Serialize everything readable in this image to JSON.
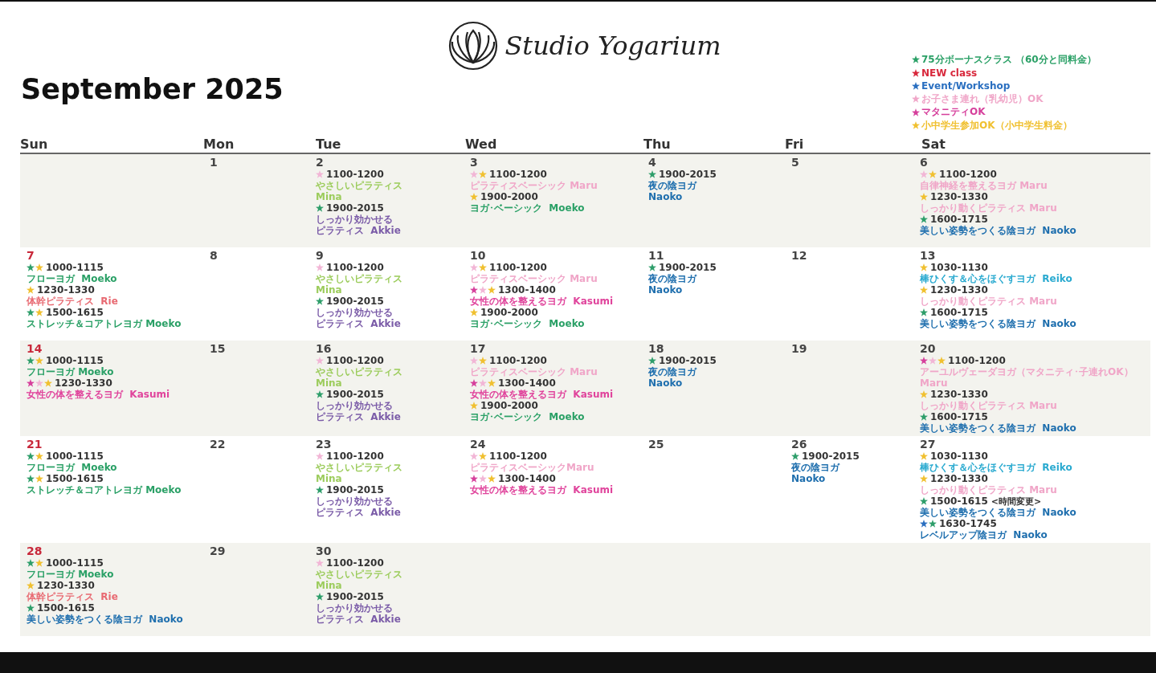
{
  "logo": {
    "text": "Studio Yogarium"
  },
  "title": "September 2025",
  "legend": [
    {
      "color": "#2aa066",
      "text": "75分ボーナスクラス （60分と同料金）"
    },
    {
      "color": "#d8283c",
      "text": "NEW class"
    },
    {
      "color": "#2a6fc0",
      "text": "Event/Workshop"
    },
    {
      "color": "#f0a6c8",
      "text": "お子さま連れ（乳幼児）OK"
    },
    {
      "color": "#d6409c",
      "text": "マタニティOK"
    },
    {
      "color": "#f0c030",
      "text": "小中学生参加OK（小中学生料金）"
    }
  ],
  "weekdays": [
    "Sun",
    "Mon",
    "Tue",
    "Wed",
    "Thu",
    "Fri",
    "Sat"
  ],
  "weeks": [
    {
      "shaded": true,
      "days": [
        {
          "date": "1"
        },
        {
          "date": "2",
          "classes": [
            {
              "stars": [
                {
                  "color": "#f2b6d6"
                }
              ],
              "time": "1100-1200",
              "lines": [
                "やさしいピラティス",
                "Mina"
              ],
              "color": "#9ccc5c"
            },
            {
              "stars": [
                {
                  "color": "#2e9e6a"
                }
              ],
              "time": "1900-2015",
              "lines": [
                "しっかり効かせる",
                "ピラティス  Akkie"
              ],
              "color": "#7b5ca8"
            }
          ]
        },
        {
          "date": "3",
          "classes": [
            {
              "stars": [
                {
                  "color": "#f2b6d6"
                },
                {
                  "color": "#f0c030"
                }
              ],
              "time": "1100-1200",
              "lines": [
                "ピラティスベーシック Maru"
              ],
              "color": "#f0a6c8"
            },
            {
              "stars": [
                {
                  "color": "#f0c030"
                }
              ],
              "time": "1900-2000",
              "lines": [
                "ヨガ･ベーシック  Moeko"
              ],
              "color": "#2aa066"
            }
          ]
        },
        {
          "date": "4",
          "classes": [
            {
              "stars": [
                {
                  "color": "#2e9e6a"
                }
              ],
              "time": "1900-2015",
              "lines": [
                "夜の陰ヨガ",
                "Naoko"
              ],
              "color": "#1f6fae"
            }
          ]
        },
        {
          "date": "5"
        },
        {
          "date": "6",
          "classes": [
            {
              "stars": [
                {
                  "color": "#f2b6d6"
                },
                {
                  "color": "#f0c030"
                }
              ],
              "time": "1100-1200",
              "lines": [
                "自律神経を整えるヨガ Maru"
              ],
              "color": "#f0a6c8"
            },
            {
              "stars": [
                {
                  "color": "#f0c030"
                }
              ],
              "time": "1230-1330",
              "lines": [
                "しっかり動くピラティス Maru"
              ],
              "color": "#f0a6c8"
            },
            {
              "stars": [
                {
                  "color": "#2e9e6a"
                }
              ],
              "time": "1600-1715",
              "lines": [
                "美しい姿勢をつくる陰ヨガ  Naoko"
              ],
              "color": "#1f6fae"
            }
          ]
        }
      ]
    },
    {
      "shaded": false,
      "days": [
        {
          "date": "7",
          "classes": [
            {
              "stars": [
                {
                  "color": "#2e9e6a"
                },
                {
                  "color": "#f0c030"
                }
              ],
              "time": "1000-1115",
              "lines": [
                "フローヨガ  Moeko"
              ],
              "color": "#2aa066"
            },
            {
              "stars": [
                {
                  "color": "#f0c030"
                }
              ],
              "time": "1230-1330",
              "lines": [
                "体幹ピラティス  Rie"
              ],
              "color": "#e86a72"
            },
            {
              "stars": [
                {
                  "color": "#2e9e6a"
                },
                {
                  "color": "#f0c030"
                }
              ],
              "time": "1500-1615",
              "lines": [
                "ストレッチ＆コアトレヨガ Moeko"
              ],
              "color": "#2aa066"
            }
          ]
        },
        {
          "date": "8"
        },
        {
          "date": "9",
          "classes": [
            {
              "stars": [
                {
                  "color": "#f2b6d6"
                }
              ],
              "time": "1100-1200",
              "lines": [
                "やさしいピラティス",
                "Mina"
              ],
              "color": "#9ccc5c"
            },
            {
              "stars": [
                {
                  "color": "#2e9e6a"
                }
              ],
              "time": "1900-2015",
              "lines": [
                "しっかり効かせる",
                "ピラティス  Akkie"
              ],
              "color": "#7b5ca8"
            }
          ]
        },
        {
          "date": "10",
          "classes": [
            {
              "stars": [
                {
                  "color": "#f2b6d6"
                },
                {
                  "color": "#f0c030"
                }
              ],
              "time": "1100-1200",
              "lines": [
                "ピラティスベーシック Maru"
              ],
              "color": "#f0a6c8"
            },
            {
              "stars": [
                {
                  "color": "#d6409c"
                },
                {
                  "color": "#f2b6d6"
                },
                {
                  "color": "#f0c030"
                }
              ],
              "time": "1300-1400",
              "lines": [
                "女性の体を整えるヨガ  Kasumi"
              ],
              "color": "#e0449c"
            },
            {
              "stars": [
                {
                  "color": "#f0c030"
                }
              ],
              "time": "1900-2000",
              "lines": [
                "ヨガ･ベーシック  Moeko"
              ],
              "color": "#2aa066"
            }
          ]
        },
        {
          "date": "11",
          "classes": [
            {
              "stars": [
                {
                  "color": "#2e9e6a"
                }
              ],
              "time": "1900-2015",
              "lines": [
                "夜の陰ヨガ",
                "Naoko"
              ],
              "color": "#1f6fae"
            }
          ]
        },
        {
          "date": "12"
        },
        {
          "date": "13",
          "classes": [
            {
              "stars": [
                {
                  "color": "#f0c030"
                }
              ],
              "time": "1030-1130",
              "lines": [
                "棒ひくす＆心をほぐすヨガ  Reiko"
              ],
              "color": "#2aaad0"
            },
            {
              "stars": [
                {
                  "color": "#f0c030"
                }
              ],
              "time": "1230-1330",
              "lines": [
                "しっかり動くピラティス Maru"
              ],
              "color": "#f0a6c8"
            },
            {
              "stars": [
                {
                  "color": "#2e9e6a"
                }
              ],
              "time": "1600-1715",
              "lines": [
                "美しい姿勢をつくる陰ヨガ  Naoko"
              ],
              "color": "#1f6fae"
            }
          ]
        }
      ]
    },
    {
      "shaded": true,
      "days": [
        {
          "date": "14",
          "classes": [
            {
              "stars": [
                {
                  "color": "#2e9e6a"
                },
                {
                  "color": "#f0c030"
                }
              ],
              "time": "1000-1115",
              "lines": [
                "フローヨガ Moeko"
              ],
              "color": "#2aa066"
            },
            {
              "stars": [
                {
                  "color": "#d6409c"
                },
                {
                  "color": "#f2b6d6"
                },
                {
                  "color": "#f0c030"
                }
              ],
              "time": "1230-1330",
              "lines": [
                "女性の体を整えるヨガ  Kasumi"
              ],
              "color": "#e0449c"
            }
          ]
        },
        {
          "date": "15"
        },
        {
          "date": "16",
          "classes": [
            {
              "stars": [
                {
                  "color": "#f2b6d6"
                }
              ],
              "time": "1100-1200",
              "lines": [
                "やさしいピラティス",
                "Mina"
              ],
              "color": "#9ccc5c"
            },
            {
              "stars": [
                {
                  "color": "#2e9e6a"
                }
              ],
              "time": "1900-2015",
              "lines": [
                "しっかり効かせる",
                "ピラティス  Akkie"
              ],
              "color": "#7b5ca8"
            }
          ]
        },
        {
          "date": "17",
          "classes": [
            {
              "stars": [
                {
                  "color": "#f2b6d6"
                },
                {
                  "color": "#f0c030"
                }
              ],
              "time": "1100-1200",
              "lines": [
                "ピラティスベーシック Maru"
              ],
              "color": "#f0a6c8"
            },
            {
              "stars": [
                {
                  "color": "#d6409c"
                },
                {
                  "color": "#f2b6d6"
                },
                {
                  "color": "#f0c030"
                }
              ],
              "time": "1300-1400",
              "lines": [
                "女性の体を整えるヨガ  Kasumi"
              ],
              "color": "#e0449c"
            },
            {
              "stars": [
                {
                  "color": "#f0c030"
                }
              ],
              "time": "1900-2000",
              "lines": [
                "ヨガ･ベーシック  Moeko"
              ],
              "color": "#2aa066"
            }
          ]
        },
        {
          "date": "18",
          "classes": [
            {
              "stars": [
                {
                  "color": "#2e9e6a"
                }
              ],
              "time": "1900-2015",
              "lines": [
                "夜の陰ヨガ",
                "Naoko"
              ],
              "color": "#1f6fae"
            }
          ]
        },
        {
          "date": "19"
        },
        {
          "date": "20",
          "classes": [
            {
              "stars": [
                {
                  "color": "#d6409c"
                },
                {
                  "color": "#f2b6d6"
                },
                {
                  "color": "#f0c030"
                }
              ],
              "time": "1100-1200",
              "lines": [
                "アーユルヴェーダヨガ（マタニティ･子連れOK）",
                "Maru"
              ],
              "color": "#f0a6c8"
            },
            {
              "stars": [
                {
                  "color": "#f0c030"
                }
              ],
              "time": "1230-1330",
              "lines": [
                "しっかり動くピラティス Maru"
              ],
              "color": "#f0a6c8"
            },
            {
              "stars": [
                {
                  "color": "#2e9e6a"
                }
              ],
              "time": "1600-1715",
              "lines": [
                "美しい姿勢をつくる陰ヨガ  Naoko"
              ],
              "color": "#1f6fae"
            }
          ]
        }
      ]
    },
    {
      "shaded": false,
      "days": [
        {
          "date": "21",
          "classes": [
            {
              "stars": [
                {
                  "color": "#2e9e6a"
                },
                {
                  "color": "#f0c030"
                }
              ],
              "time": "1000-1115",
              "lines": [
                "フローヨガ  Moeko"
              ],
              "color": "#2aa066"
            },
            {
              "stars": [
                {
                  "color": "#2e9e6a"
                },
                {
                  "color": "#f0c030"
                }
              ],
              "time": "1500-1615",
              "lines": [
                "ストレッチ＆コアトレヨガ Moeko"
              ],
              "color": "#2aa066"
            }
          ]
        },
        {
          "date": "22"
        },
        {
          "date": "23",
          "classes": [
            {
              "stars": [
                {
                  "color": "#f2b6d6"
                }
              ],
              "time": "1100-1200",
              "lines": [
                "やさしいピラティス",
                "Mina"
              ],
              "color": "#9ccc5c"
            },
            {
              "stars": [
                {
                  "color": "#2e9e6a"
                }
              ],
              "time": "1900-2015",
              "lines": [
                "しっかり効かせる",
                "ピラティス  Akkie"
              ],
              "color": "#7b5ca8"
            }
          ]
        },
        {
          "date": "24",
          "classes": [
            {
              "stars": [
                {
                  "color": "#f2b6d6"
                },
                {
                  "color": "#f0c030"
                }
              ],
              "time": "1100-1200",
              "lines": [
                "ピラティスベーシックMaru"
              ],
              "color": "#f0a6c8"
            },
            {
              "stars": [
                {
                  "color": "#d6409c"
                },
                {
                  "color": "#f2b6d6"
                },
                {
                  "color": "#f0c030"
                }
              ],
              "time": "1300-1400",
              "lines": [
                "女性の体を整えるヨガ  Kasumi"
              ],
              "color": "#e0449c"
            }
          ]
        },
        {
          "date": "25"
        },
        {
          "date": "26",
          "classes": [
            {
              "stars": [
                {
                  "color": "#2e9e6a"
                }
              ],
              "time": "1900-2015",
              "lines": [
                "夜の陰ヨガ",
                "Naoko"
              ],
              "color": "#1f6fae"
            }
          ]
        },
        {
          "date": "27",
          "classes": [
            {
              "stars": [
                {
                  "color": "#f0c030"
                }
              ],
              "time": "1030-1130",
              "lines": [
                "棒ひくす＆心をほぐすヨガ  Reiko"
              ],
              "color": "#2aaad0"
            },
            {
              "stars": [
                {
                  "color": "#f0c030"
                }
              ],
              "time": "1230-1330",
              "lines": [
                "しっかり動くピラティス Maru"
              ],
              "color": "#f0a6c8"
            },
            {
              "stars": [
                {
                  "color": "#2e9e6a"
                }
              ],
              "time": "1500-1615",
              "note": "<時間変更>",
              "lines": [
                "美しい姿勢をつくる陰ヨガ  Naoko"
              ],
              "color": "#1f6fae"
            },
            {
              "stars": [
                {
                  "color": "#2a6fc0"
                },
                {
                  "color": "#2e9e6a"
                }
              ],
              "time": "1630-1745",
              "lines": [
                "レベルアップ陰ヨガ  Naoko"
              ],
              "color": "#1f6fae"
            }
          ]
        }
      ]
    },
    {
      "shaded": true,
      "days": [
        {
          "date": "28",
          "classes": [
            {
              "stars": [
                {
                  "color": "#2e9e6a"
                },
                {
                  "color": "#f0c030"
                }
              ],
              "time": "1000-1115",
              "lines": [
                "フローヨガ Moeko"
              ],
              "color": "#2aa066"
            },
            {
              "stars": [
                {
                  "color": "#f0c030"
                }
              ],
              "time": "1230-1330",
              "lines": [
                "体幹ピラティス  Rie"
              ],
              "color": "#e86a72"
            },
            {
              "stars": [
                {
                  "color": "#2e9e6a"
                }
              ],
              "time": "1500-1615",
              "lines": [
                "美しい姿勢をつくる陰ヨガ  Naoko"
              ],
              "color": "#1f6fae"
            }
          ]
        },
        {
          "date": "29"
        },
        {
          "date": "30",
          "classes": [
            {
              "stars": [
                {
                  "color": "#f2b6d6"
                }
              ],
              "time": "1100-1200",
              "lines": [
                "やさしいピラティス",
                "Mina"
              ],
              "color": "#9ccc5c"
            },
            {
              "stars": [
                {
                  "color": "#2e9e6a"
                }
              ],
              "time": "1900-2015",
              "lines": [
                "しっかり効かせる",
                "ピラティス  Akkie"
              ],
              "color": "#7b5ca8"
            }
          ]
        }
      ]
    }
  ]
}
